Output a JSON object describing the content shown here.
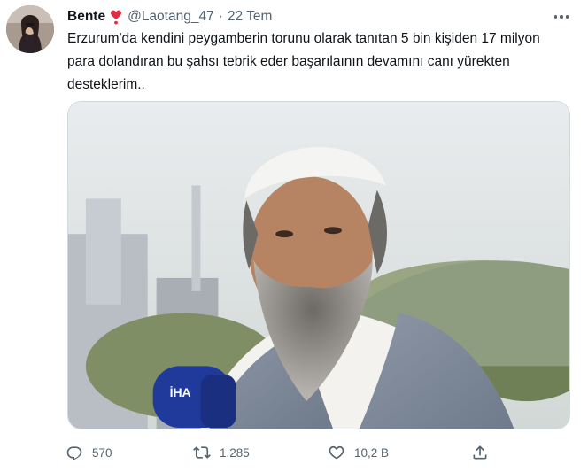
{
  "tweet": {
    "display_name": "Bente",
    "name_badge_icon": "heart-exclamation-icon",
    "handle": "@Laotang_47",
    "separator": "·",
    "date": "22 Tem",
    "text": "Erzurum'da kendini peygamberin torunu olarak tanıtan 5 bin kişiden 17 milyon para dolandıran bu şahsı tebrik eder başarılaının devamını canı yürekten desteklerim..",
    "media": {
      "microphone_label": "İHA"
    },
    "actions": {
      "reply_count": "570",
      "retweet_count": "1.285",
      "like_count": "10,2 B"
    }
  },
  "colors": {
    "text_primary": "#0f1419",
    "text_secondary": "#536471",
    "border": "#cfd9de",
    "heart_red": "#dd2e44"
  }
}
